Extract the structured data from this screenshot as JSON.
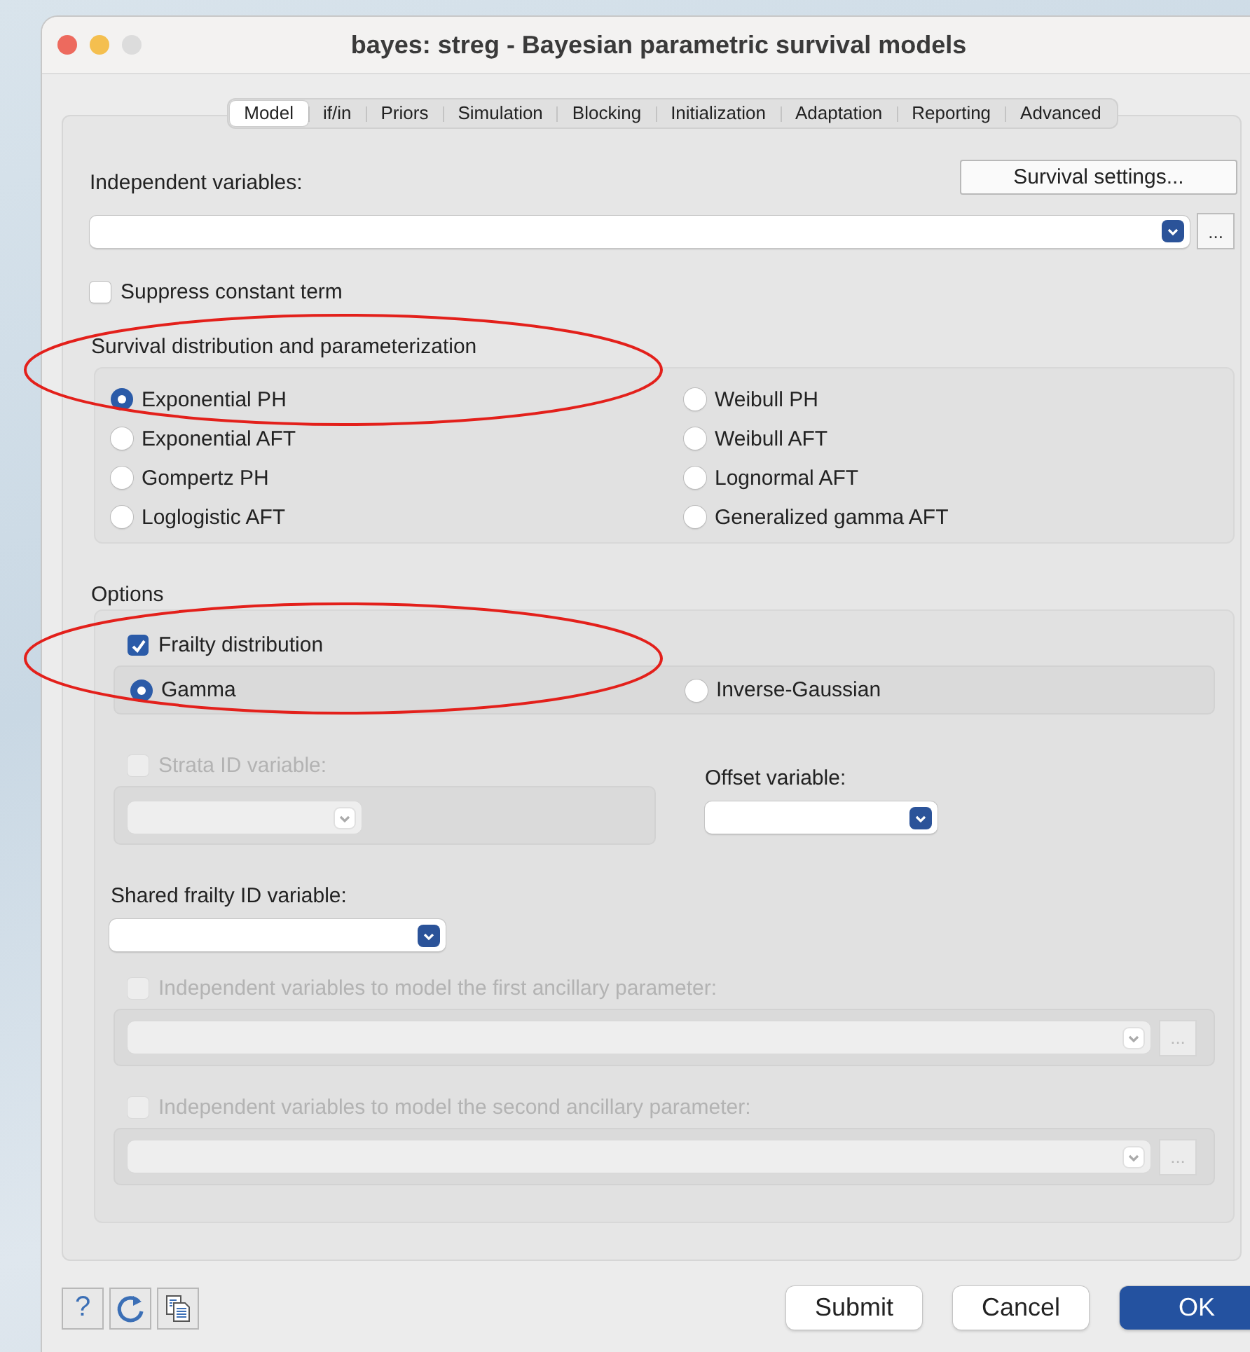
{
  "window": {
    "title": "bayes: streg - Bayesian parametric survival models"
  },
  "tabs": [
    {
      "label": "Model",
      "selected": true
    },
    {
      "label": "if/in",
      "selected": false
    },
    {
      "label": "Priors",
      "selected": false
    },
    {
      "label": "Simulation",
      "selected": false
    },
    {
      "label": "Blocking",
      "selected": false
    },
    {
      "label": "Initialization",
      "selected": false
    },
    {
      "label": "Adaptation",
      "selected": false
    },
    {
      "label": "Reporting",
      "selected": false
    },
    {
      "label": "Advanced",
      "selected": false
    }
  ],
  "independent_variables": {
    "label": "Independent variables:",
    "settings_button": "Survival settings...",
    "browse": "..."
  },
  "suppress_constant": {
    "label": "Suppress constant term",
    "checked": false
  },
  "distribution": {
    "title": "Survival distribution and parameterization",
    "options": [
      {
        "label": "Exponential PH",
        "selected": true
      },
      {
        "label": "Weibull PH",
        "selected": false
      },
      {
        "label": "Exponential AFT",
        "selected": false
      },
      {
        "label": "Weibull AFT",
        "selected": false
      },
      {
        "label": "Gompertz PH",
        "selected": false
      },
      {
        "label": "Lognormal AFT",
        "selected": false
      },
      {
        "label": "Loglogistic AFT",
        "selected": false
      },
      {
        "label": "Generalized gamma AFT",
        "selected": false
      }
    ]
  },
  "options": {
    "title": "Options",
    "frailty": {
      "label": "Frailty distribution",
      "checked": true
    },
    "frailty_types": [
      {
        "label": "Gamma",
        "selected": true
      },
      {
        "label": "Inverse-Gaussian",
        "selected": false
      }
    ],
    "strata": {
      "label": "Strata ID variable:",
      "checked": false,
      "disabled": true
    },
    "offset": {
      "label": "Offset variable:"
    },
    "shared_frailty": {
      "label": "Shared frailty ID variable:"
    },
    "ancillary": [
      {
        "label": "Independent variables to model the first ancillary parameter:",
        "checked": false,
        "disabled": true,
        "browse": "..."
      },
      {
        "label": "Independent variables to model the second ancillary parameter:",
        "checked": false,
        "disabled": true,
        "browse": "..."
      }
    ]
  },
  "footer": {
    "help": "?",
    "buttons": [
      {
        "label": "Submit",
        "kind": "plain"
      },
      {
        "label": "Cancel",
        "kind": "plain"
      },
      {
        "label": "OK",
        "kind": "default"
      }
    ]
  },
  "annotations": [
    {
      "kind": "ellipse"
    },
    {
      "kind": "ellipse"
    }
  ]
}
